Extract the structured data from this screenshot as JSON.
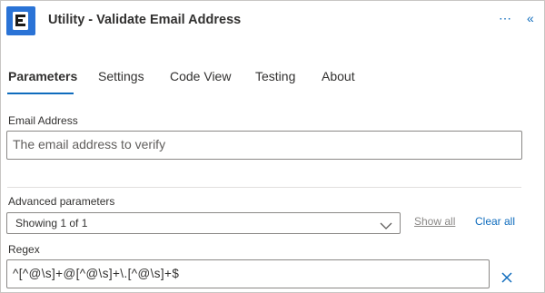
{
  "header": {
    "title": "Utility - Validate Email Address",
    "more_icon": "more-horizontal-icon",
    "collapse_icon": "chevron-double-left-icon",
    "more_glyph": "⋯",
    "collapse_glyph": "«",
    "accent": "#0f6cbd",
    "icon_color": "#2a73d6"
  },
  "tabs": [
    {
      "label": "Parameters",
      "active": true
    },
    {
      "label": "Settings",
      "active": false
    },
    {
      "label": "Code View",
      "active": false
    },
    {
      "label": "Testing",
      "active": false
    },
    {
      "label": "About",
      "active": false
    }
  ],
  "email": {
    "label": "Email Address",
    "placeholder": "The email address to verify"
  },
  "advanced": {
    "label": "Advanced parameters",
    "selected": "Showing 1 of 1",
    "show_all": "Show all",
    "clear_all": "Clear all"
  },
  "regex": {
    "label": "Regex",
    "value": "^[^@\\s]+@[^@\\s]+\\.[^@\\s]+$"
  }
}
